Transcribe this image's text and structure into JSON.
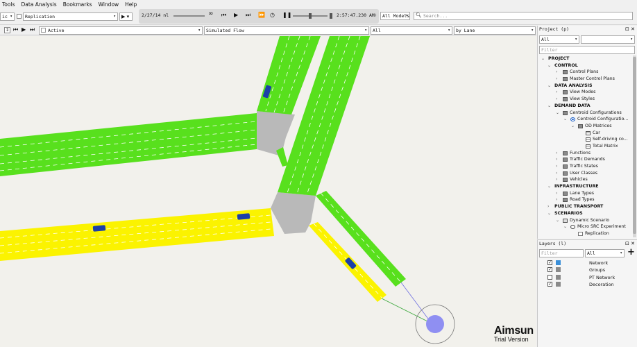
{
  "menubar": [
    "Tools",
    "Data Analysis",
    "Bookmarks",
    "Window",
    "Help"
  ],
  "toolbar": {
    "mode_combo": "ic",
    "replication_combo": "Replication",
    "date": "2/27/14 nl",
    "time": "2:57:47.230 AM",
    "models_combo": "All Models",
    "search_placeholder": "Search..."
  },
  "viewbar": {
    "active_combo": "Active",
    "flow_combo": "Simulated Flow",
    "all_combo": "All",
    "lane_combo": "by Lane"
  },
  "project_panel": {
    "title": "Project (p)",
    "filter_combo": "All",
    "filter_placeholder": "Filter",
    "tree": [
      {
        "label": "PROJECT",
        "depth": 0,
        "bold": true,
        "twist": "v"
      },
      {
        "label": "CONTROL",
        "depth": 1,
        "bold": true,
        "twist": "v"
      },
      {
        "label": "Control Plans",
        "depth": 2,
        "bold": false,
        "twist": ">",
        "icon": "folder"
      },
      {
        "label": "Master Control Plans",
        "depth": 2,
        "bold": false,
        "twist": ">",
        "icon": "folder"
      },
      {
        "label": "DATA ANALYSIS",
        "depth": 1,
        "bold": true,
        "twist": "v"
      },
      {
        "label": "View Modes",
        "depth": 2,
        "bold": false,
        "twist": ">",
        "icon": "folder"
      },
      {
        "label": "View Styles",
        "depth": 2,
        "bold": false,
        "twist": ">",
        "icon": "folder"
      },
      {
        "label": "DEMAND DATA",
        "depth": 1,
        "bold": true,
        "twist": "v"
      },
      {
        "label": "Centroid Configurations",
        "depth": 2,
        "bold": false,
        "twist": "v",
        "icon": "folder"
      },
      {
        "label": "Centroid Configuratio...",
        "depth": 3,
        "bold": false,
        "twist": "v",
        "icon": "radio"
      },
      {
        "label": "OD Matrices",
        "depth": 4,
        "bold": false,
        "twist": "v",
        "icon": "folder"
      },
      {
        "label": "Car",
        "depth": 5,
        "bold": false,
        "twist": "",
        "icon": "grid"
      },
      {
        "label": "Self-driving co...",
        "depth": 5,
        "bold": false,
        "twist": "",
        "icon": "grid"
      },
      {
        "label": "Total Matrix",
        "depth": 5,
        "bold": false,
        "twist": "",
        "icon": "grid"
      },
      {
        "label": "Functions",
        "depth": 2,
        "bold": false,
        "twist": ">",
        "icon": "folder"
      },
      {
        "label": "Traffic Demands",
        "depth": 2,
        "bold": false,
        "twist": ">",
        "icon": "folder"
      },
      {
        "label": "Traffic States",
        "depth": 2,
        "bold": false,
        "twist": ">",
        "icon": "folder"
      },
      {
        "label": "User Classes",
        "depth": 2,
        "bold": false,
        "twist": ">",
        "icon": "folder"
      },
      {
        "label": "Vehicles",
        "depth": 2,
        "bold": false,
        "twist": ">",
        "icon": "folder"
      },
      {
        "label": "INFRASTRUCTURE",
        "depth": 1,
        "bold": true,
        "twist": "v"
      },
      {
        "label": "Lane Types",
        "depth": 2,
        "bold": false,
        "twist": ">",
        "icon": "folder"
      },
      {
        "label": "Road Types",
        "depth": 2,
        "bold": false,
        "twist": ">",
        "icon": "folder"
      },
      {
        "label": "PUBLIC TRANSPORT",
        "depth": 1,
        "bold": true,
        "twist": ">"
      },
      {
        "label": "SCENARIOS",
        "depth": 1,
        "bold": true,
        "twist": "v"
      },
      {
        "label": "Dynamic Scenario",
        "depth": 2,
        "bold": false,
        "twist": "v",
        "icon": "scenario"
      },
      {
        "label": "Micro SRC Experiment",
        "depth": 3,
        "bold": false,
        "twist": "v",
        "icon": "circle"
      },
      {
        "label": "Replication",
        "depth": 4,
        "bold": false,
        "twist": "",
        "icon": "doc"
      }
    ]
  },
  "layers_panel": {
    "title": "Layers (l)",
    "filter_placeholder": "Filter",
    "filter_combo": "All",
    "add_label": "+",
    "layers": [
      {
        "label": "Network",
        "checked": true,
        "color": "#3a8fd9"
      },
      {
        "label": "Groups",
        "checked": true,
        "color": "#8a8a8a"
      },
      {
        "label": "PT Network",
        "checked": false,
        "color": "#8a8a8a"
      },
      {
        "label": "Decoration",
        "checked": true,
        "color": "#8a8a8a"
      }
    ]
  },
  "branding": {
    "name": "Aimsun",
    "edition": "Trial Version"
  },
  "colors": {
    "green_road": "#58e01d",
    "yellow_road": "#fbf300",
    "junction": "#b9b9b9",
    "vehicle": "#1c3fa8",
    "centroid": "#8f8ff2"
  }
}
